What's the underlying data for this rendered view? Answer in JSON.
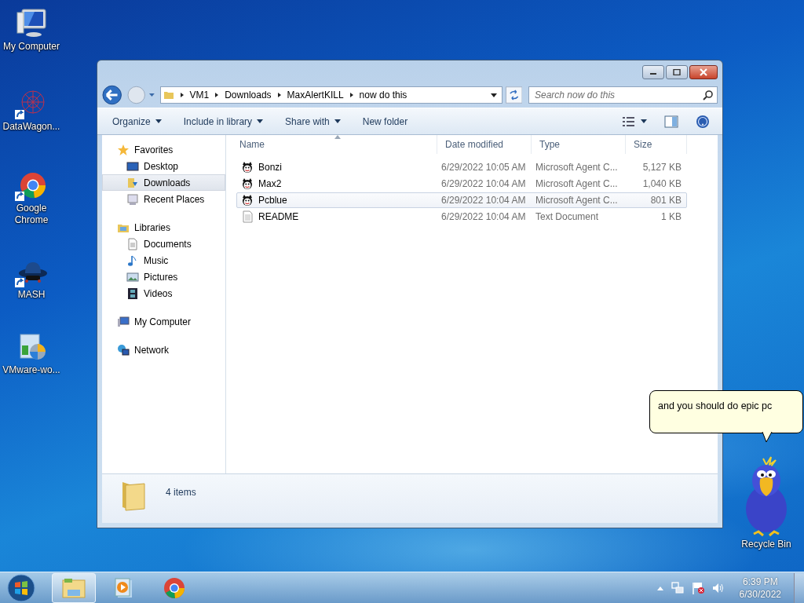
{
  "desktop_icons": [
    {
      "label": "My Computer",
      "kind": "computer",
      "shortcut": false
    },
    {
      "label": "DataWagon...",
      "kind": "web",
      "shortcut": true
    },
    {
      "label": "Google Chrome",
      "kind": "chrome",
      "shortcut": true
    },
    {
      "label": "MASH",
      "kind": "hat",
      "shortcut": true
    },
    {
      "label": "VMware-wo...",
      "kind": "installer",
      "shortcut": false
    }
  ],
  "recycle_bin": {
    "label": "Recycle Bin"
  },
  "window": {
    "address": [
      "VM1",
      "Downloads",
      "MaxAlertKILL",
      "now do this"
    ],
    "search": {
      "placeholder": "Search now do this"
    },
    "toolbar": [
      {
        "label": "Organize",
        "dropdown": true
      },
      {
        "label": "Include in library",
        "dropdown": true
      },
      {
        "label": "Share with",
        "dropdown": true
      },
      {
        "label": "New folder",
        "dropdown": false
      }
    ],
    "sidebar": [
      {
        "label": "Favorites",
        "kind": "star",
        "children": [
          {
            "label": "Desktop",
            "kind": "desktop",
            "selected": false
          },
          {
            "label": "Downloads",
            "kind": "downloads",
            "selected": true
          },
          {
            "label": "Recent Places",
            "kind": "recent",
            "selected": false
          }
        ]
      },
      {
        "label": "Libraries",
        "kind": "library",
        "children": [
          {
            "label": "Documents",
            "kind": "doc",
            "selected": false
          },
          {
            "label": "Music",
            "kind": "music",
            "selected": false
          },
          {
            "label": "Pictures",
            "kind": "pictures",
            "selected": false
          },
          {
            "label": "Videos",
            "kind": "videos",
            "selected": false
          }
        ]
      },
      {
        "label": "My Computer",
        "kind": "computer"
      },
      {
        "label": "Network",
        "kind": "network"
      }
    ],
    "columns": [
      {
        "label": "Name",
        "sorted": true
      },
      {
        "label": "Date modified",
        "sorted": false
      },
      {
        "label": "Type",
        "sorted": false
      },
      {
        "label": "Size",
        "sorted": false
      }
    ],
    "files": [
      {
        "name": "Bonzi",
        "date": "6/29/2022 10:05 AM",
        "type": "Microsoft Agent C...",
        "size": "5,127 KB",
        "kind": "agent",
        "selected": false
      },
      {
        "name": "Max2",
        "date": "6/29/2022 10:04 AM",
        "type": "Microsoft Agent C...",
        "size": "1,040 KB",
        "kind": "agent",
        "selected": false
      },
      {
        "name": "Pcblue",
        "date": "6/29/2022 10:04 AM",
        "type": "Microsoft Agent C...",
        "size": "801 KB",
        "kind": "agent",
        "selected": true
      },
      {
        "name": "README",
        "date": "6/29/2022 10:04 AM",
        "type": "Text Document",
        "size": "1 KB",
        "kind": "text",
        "selected": false
      }
    ],
    "details": {
      "count": "4 items"
    }
  },
  "agent": {
    "speech": "and you should do epic pc"
  },
  "taskbar": {
    "pinned": [
      {
        "kind": "explorer",
        "selected": true
      },
      {
        "kind": "media",
        "selected": false
      },
      {
        "kind": "chrome",
        "selected": false
      }
    ],
    "time": "6:39 PM",
    "date": "6/30/2022"
  }
}
